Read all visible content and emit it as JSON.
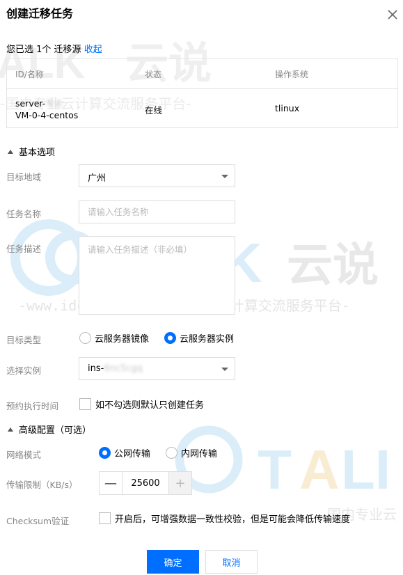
{
  "dialog": {
    "title": "创建迁移任务"
  },
  "selection": {
    "prefix": "您已选 1个",
    "source_label": "迁移源",
    "collapse_link": "收起"
  },
  "source_table": {
    "headers": [
      "ID/名称",
      "状态",
      "操作系统"
    ],
    "rows": [
      {
        "id_line1_prefix": "server-",
        "id_line1_blurred": "专业",
        "id_line2": "VM-0-4-centos",
        "status": "在线",
        "os": "tlinux"
      }
    ]
  },
  "basic": {
    "section_title": "基本选项",
    "target_region_label": "目标地域",
    "target_region_value": "广州",
    "task_name_label": "任务名称",
    "task_name_placeholder": "请输入任务名称",
    "task_desc_label": "任务描述",
    "task_desc_placeholder": "请输入任务描述（非必填）",
    "target_type_label": "目标类型",
    "target_type_options": [
      "云服务器镜像",
      "云服务器实例"
    ],
    "target_type_selected": "云服务器实例",
    "instance_label": "选择实例",
    "instance_value_prefix": "ins-",
    "instance_value_blurred": "6nc5cgq",
    "schedule_label": "预约执行时间",
    "schedule_checkbox_text": "如不勾选则默认只创建任务"
  },
  "advanced": {
    "section_title": "高级配置（可选）",
    "network_label": "网络模式",
    "network_options": [
      "公网传输",
      "内网传输"
    ],
    "network_selected": "公网传输",
    "limit_label": "传输限制（KB/s）",
    "limit_value": "25600",
    "checksum_label": "Checksum验证",
    "checksum_text": "开启后，可增强数据一致性校验，但是可能会降低传输速度"
  },
  "footer": {
    "confirm_label": "确定",
    "cancel_label": "取消"
  },
  "watermark": {
    "logo_text": "TALK 云说",
    "line_text": "-www.idctalk.com-国内专业云计算交流服务平台-"
  },
  "colors": {
    "accent": "#006eff",
    "watermark_blue": "#cfe6f6",
    "watermark_gray": "#e4e4e4",
    "watermark_gold": "#f5e7c8"
  }
}
